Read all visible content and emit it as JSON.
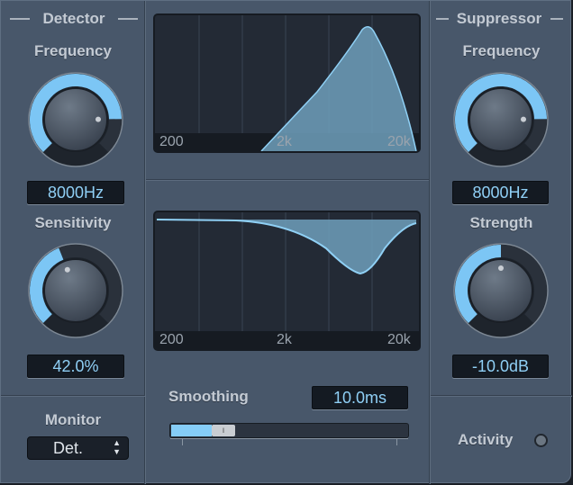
{
  "detector": {
    "title": "Detector",
    "frequency_label": "Frequency",
    "frequency_value": "8000Hz",
    "frequency_knob_level": 0.83,
    "sensitivity_label": "Sensitivity",
    "sensitivity_value": "42.0%",
    "sensitivity_knob_level": 0.42
  },
  "suppressor": {
    "title": "Suppressor",
    "frequency_label": "Frequency",
    "frequency_value": "8000Hz",
    "frequency_knob_level": 0.83,
    "strength_label": "Strength",
    "strength_value": "-10.0dB",
    "strength_knob_level": 0.5
  },
  "monitor": {
    "label": "Monitor",
    "value": "Det."
  },
  "activity": {
    "label": "Activity"
  },
  "smoothing": {
    "label": "Smoothing",
    "value": "10.0ms",
    "slider_level": 0.17
  },
  "graphs": {
    "axis_labels": [
      "200",
      "2k",
      "20k"
    ]
  },
  "colors": {
    "accent": "#7cc6f5",
    "panel": "#48576a",
    "display": "#232a35"
  }
}
